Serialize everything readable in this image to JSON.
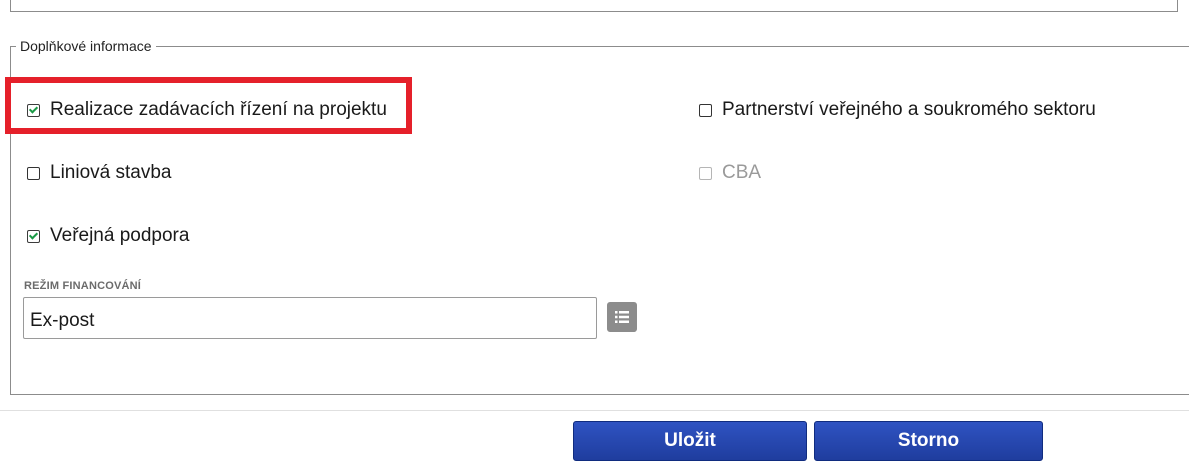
{
  "section": {
    "legend": "Doplňkové informace"
  },
  "checkboxes": {
    "realizace": {
      "label": "Realizace zadávacích řízení na projektu",
      "checked": true
    },
    "partnerstvi": {
      "label": "Partnerství veřejného a soukromého sektoru",
      "checked": false
    },
    "liniova": {
      "label": "Liniová stavba",
      "checked": false
    },
    "cba": {
      "label": "CBA",
      "checked": false,
      "disabled": true
    },
    "verejna": {
      "label": "Veřejná podpora",
      "checked": true
    }
  },
  "financovani": {
    "label": "REŽIM FINANCOVÁNÍ",
    "value": "Ex-post",
    "list_icon": "list-icon"
  },
  "actions": {
    "save_label": "Uložit",
    "cancel_label": "Storno"
  },
  "colors": {
    "highlight": "#e5202a",
    "check": "#1a9a46",
    "button": "#2a4bb5"
  }
}
